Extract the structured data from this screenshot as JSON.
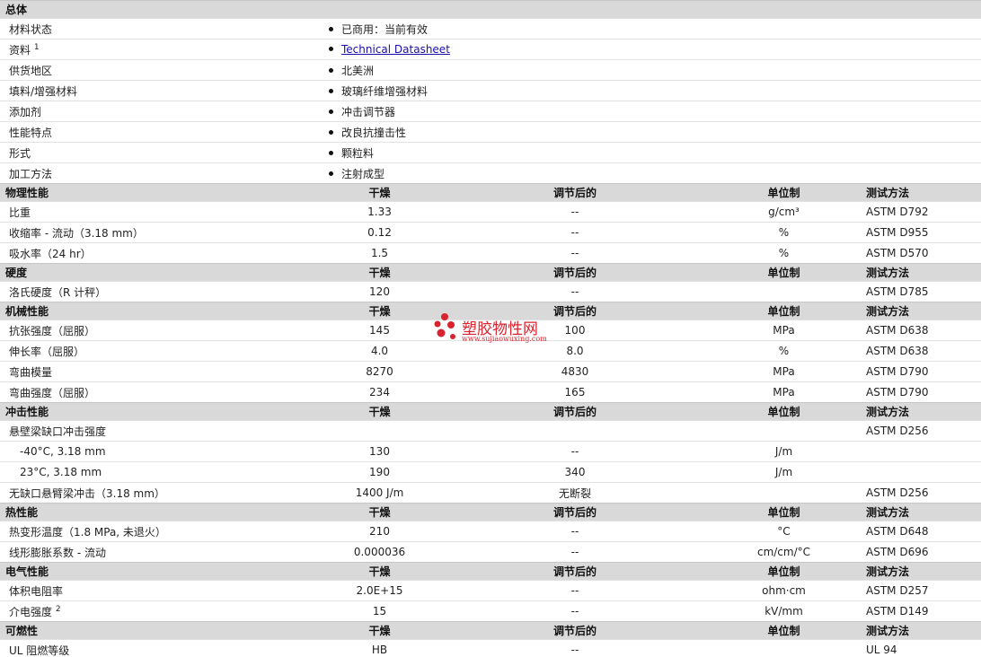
{
  "general": {
    "title": "总体",
    "rows": [
      {
        "label": "材料状态",
        "value": "已商用：当前有效"
      },
      {
        "label": "资料",
        "sup": "1",
        "value": "Technical Datasheet",
        "link": true
      },
      {
        "label": "供货地区",
        "value": "北美洲"
      },
      {
        "label": "填料/增强材料",
        "value": "玻璃纤维增强材料"
      },
      {
        "label": "添加剂",
        "value": "冲击调节器"
      },
      {
        "label": "性能特点",
        "value": "改良抗撞击性"
      },
      {
        "label": "形式",
        "value": "颗粒料"
      },
      {
        "label": "加工方法",
        "value": "注射成型"
      }
    ]
  },
  "columns": {
    "dry": "干燥",
    "cond": "调节后的",
    "unit": "单位制",
    "method": "测试方法"
  },
  "sections": [
    {
      "title": "物理性能",
      "rows": [
        {
          "label": "比重",
          "dry": "1.33",
          "cond": "--",
          "unit": "g/cm³",
          "method": "ASTM D792"
        },
        {
          "label": "收缩率 - 流动（3.18 mm）",
          "dry": "0.12",
          "cond": "--",
          "unit": "%",
          "method": "ASTM D955"
        },
        {
          "label": "吸水率（24 hr）",
          "dry": "1.5",
          "cond": "--",
          "unit": "%",
          "method": "ASTM D570"
        }
      ]
    },
    {
      "title": "硬度",
      "rows": [
        {
          "label": "洛氏硬度（R 计秤）",
          "dry": "120",
          "cond": "--",
          "unit": "",
          "method": "ASTM D785"
        }
      ]
    },
    {
      "title": "机械性能",
      "rows": [
        {
          "label": "抗张强度（屈服）",
          "dry": "145",
          "cond": "100",
          "unit": "MPa",
          "method": "ASTM D638"
        },
        {
          "label": "伸长率（屈服）",
          "dry": "4.0",
          "cond": "8.0",
          "unit": "%",
          "method": "ASTM D638"
        },
        {
          "label": "弯曲模量",
          "dry": "8270",
          "cond": "4830",
          "unit": "MPa",
          "method": "ASTM D790"
        },
        {
          "label": "弯曲强度（屈服）",
          "dry": "234",
          "cond": "165",
          "unit": "MPa",
          "method": "ASTM D790"
        }
      ]
    },
    {
      "title": "冲击性能",
      "rows": [
        {
          "label": "悬壁梁缺口冲击强度",
          "dry": "",
          "cond": "",
          "unit": "",
          "method": "ASTM D256"
        },
        {
          "label": "-40°C, 3.18 mm",
          "sub": true,
          "dry": "130",
          "cond": "--",
          "unit": "J/m",
          "method": ""
        },
        {
          "label": "23°C, 3.18 mm",
          "sub": true,
          "dry": "190",
          "cond": "340",
          "unit": "J/m",
          "method": ""
        },
        {
          "label": "无缺口悬臂梁冲击（3.18 mm）",
          "dry": "1400 J/m",
          "cond": "无断裂",
          "unit": "",
          "method": "ASTM D256"
        }
      ]
    },
    {
      "title": "热性能",
      "rows": [
        {
          "label": "热变形温度（1.8 MPa, 未退火）",
          "dry": "210",
          "cond": "--",
          "unit": "°C",
          "method": "ASTM D648"
        },
        {
          "label": "线形膨胀系数 - 流动",
          "dry": "0.000036",
          "cond": "--",
          "unit": "cm/cm/°C",
          "method": "ASTM D696"
        }
      ]
    },
    {
      "title": "电气性能",
      "rows": [
        {
          "label": "体积电阻率",
          "dry": "2.0E+15",
          "cond": "--",
          "unit": "ohm·cm",
          "method": "ASTM D257"
        },
        {
          "label": "介电强度",
          "sup": "2",
          "dry": "15",
          "cond": "--",
          "unit": "kV/mm",
          "method": "ASTM D149"
        }
      ]
    },
    {
      "title": "可燃性",
      "rows": [
        {
          "label": "UL 阻燃等级",
          "dry": "HB",
          "cond": "--",
          "unit": "",
          "method": "UL 94"
        }
      ]
    }
  ],
  "watermark": {
    "name": "塑胶物性网",
    "url": "www.sujiaowuxing.com",
    "color": "#d9232e"
  }
}
